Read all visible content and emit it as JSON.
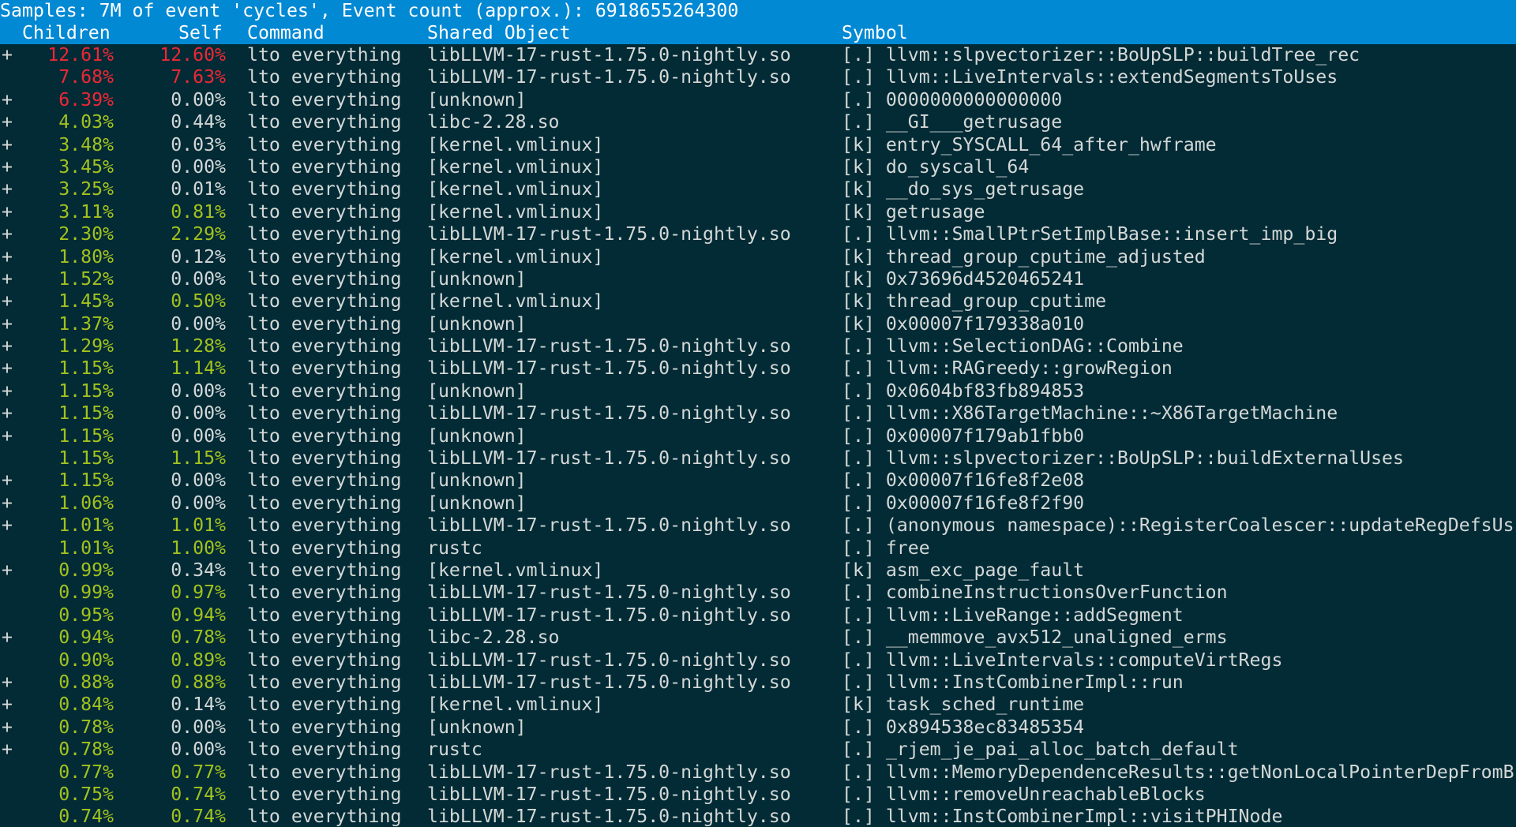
{
  "title": "Samples: 7M of event 'cycles', Event count (approx.): 6918655264300",
  "headers": {
    "children": "Children",
    "self": "Self",
    "command": "Command",
    "shared_object": "Shared Object",
    "symbol": "Symbol"
  },
  "colors": {
    "title_bar": "#0289d4",
    "background": "#022b36",
    "red": "#ee2834",
    "green": "#a3c21d",
    "default": "#d4d8d6"
  },
  "rows": [
    {
      "exp": "+",
      "children": "12.61%",
      "self": "12.60%",
      "cc": "red",
      "sc": "red",
      "cmd": "lto everything",
      "dso": "libLLVM-17-rust-1.75.0-nightly.so",
      "sym": "[.] llvm::slpvectorizer::BoUpSLP::buildTree_rec"
    },
    {
      "exp": "",
      "children": "7.68%",
      "self": "7.63%",
      "cc": "red",
      "sc": "red",
      "cmd": "lto everything",
      "dso": "libLLVM-17-rust-1.75.0-nightly.so",
      "sym": "[.] llvm::LiveIntervals::extendSegmentsToUses"
    },
    {
      "exp": "+",
      "children": "6.39%",
      "self": "0.00%",
      "cc": "red",
      "sc": "white",
      "cmd": "lto everything",
      "dso": "[unknown]",
      "sym": "[.] 0000000000000000"
    },
    {
      "exp": "+",
      "children": "4.03%",
      "self": "0.44%",
      "cc": "green",
      "sc": "white",
      "cmd": "lto everything",
      "dso": "libc-2.28.so",
      "sym": "[.] __GI___getrusage"
    },
    {
      "exp": "+",
      "children": "3.48%",
      "self": "0.03%",
      "cc": "green",
      "sc": "white",
      "cmd": "lto everything",
      "dso": "[kernel.vmlinux]",
      "sym": "[k] entry_SYSCALL_64_after_hwframe"
    },
    {
      "exp": "+",
      "children": "3.45%",
      "self": "0.00%",
      "cc": "green",
      "sc": "white",
      "cmd": "lto everything",
      "dso": "[kernel.vmlinux]",
      "sym": "[k] do_syscall_64"
    },
    {
      "exp": "+",
      "children": "3.25%",
      "self": "0.01%",
      "cc": "green",
      "sc": "white",
      "cmd": "lto everything",
      "dso": "[kernel.vmlinux]",
      "sym": "[k] __do_sys_getrusage"
    },
    {
      "exp": "+",
      "children": "3.11%",
      "self": "0.81%",
      "cc": "green",
      "sc": "green",
      "cmd": "lto everything",
      "dso": "[kernel.vmlinux]",
      "sym": "[k] getrusage"
    },
    {
      "exp": "+",
      "children": "2.30%",
      "self": "2.29%",
      "cc": "green",
      "sc": "green",
      "cmd": "lto everything",
      "dso": "libLLVM-17-rust-1.75.0-nightly.so",
      "sym": "[.] llvm::SmallPtrSetImplBase::insert_imp_big"
    },
    {
      "exp": "+",
      "children": "1.80%",
      "self": "0.12%",
      "cc": "green",
      "sc": "white",
      "cmd": "lto everything",
      "dso": "[kernel.vmlinux]",
      "sym": "[k] thread_group_cputime_adjusted"
    },
    {
      "exp": "+",
      "children": "1.52%",
      "self": "0.00%",
      "cc": "green",
      "sc": "white",
      "cmd": "lto everything",
      "dso": "[unknown]",
      "sym": "[k] 0x73696d4520465241"
    },
    {
      "exp": "+",
      "children": "1.45%",
      "self": "0.50%",
      "cc": "green",
      "sc": "green",
      "cmd": "lto everything",
      "dso": "[kernel.vmlinux]",
      "sym": "[k] thread_group_cputime"
    },
    {
      "exp": "+",
      "children": "1.37%",
      "self": "0.00%",
      "cc": "green",
      "sc": "white",
      "cmd": "lto everything",
      "dso": "[unknown]",
      "sym": "[k] 0x00007f179338a010"
    },
    {
      "exp": "+",
      "children": "1.29%",
      "self": "1.28%",
      "cc": "green",
      "sc": "green",
      "cmd": "lto everything",
      "dso": "libLLVM-17-rust-1.75.0-nightly.so",
      "sym": "[.] llvm::SelectionDAG::Combine"
    },
    {
      "exp": "+",
      "children": "1.15%",
      "self": "1.14%",
      "cc": "green",
      "sc": "green",
      "cmd": "lto everything",
      "dso": "libLLVM-17-rust-1.75.0-nightly.so",
      "sym": "[.] llvm::RAGreedy::growRegion"
    },
    {
      "exp": "+",
      "children": "1.15%",
      "self": "0.00%",
      "cc": "green",
      "sc": "white",
      "cmd": "lto everything",
      "dso": "[unknown]",
      "sym": "[.] 0x0604bf83fb894853"
    },
    {
      "exp": "+",
      "children": "1.15%",
      "self": "0.00%",
      "cc": "green",
      "sc": "white",
      "cmd": "lto everything",
      "dso": "libLLVM-17-rust-1.75.0-nightly.so",
      "sym": "[.] llvm::X86TargetMachine::~X86TargetMachine"
    },
    {
      "exp": "+",
      "children": "1.15%",
      "self": "0.00%",
      "cc": "green",
      "sc": "white",
      "cmd": "lto everything",
      "dso": "[unknown]",
      "sym": "[.] 0x00007f179ab1fbb0"
    },
    {
      "exp": "",
      "children": "1.15%",
      "self": "1.15%",
      "cc": "green",
      "sc": "green",
      "cmd": "lto everything",
      "dso": "libLLVM-17-rust-1.75.0-nightly.so",
      "sym": "[.] llvm::slpvectorizer::BoUpSLP::buildExternalUses"
    },
    {
      "exp": "+",
      "children": "1.15%",
      "self": "0.00%",
      "cc": "green",
      "sc": "white",
      "cmd": "lto everything",
      "dso": "[unknown]",
      "sym": "[.] 0x00007f16fe8f2e08"
    },
    {
      "exp": "+",
      "children": "1.06%",
      "self": "0.00%",
      "cc": "green",
      "sc": "white",
      "cmd": "lto everything",
      "dso": "[unknown]",
      "sym": "[.] 0x00007f16fe8f2f90"
    },
    {
      "exp": "+",
      "children": "1.01%",
      "self": "1.01%",
      "cc": "green",
      "sc": "green",
      "cmd": "lto everything",
      "dso": "libLLVM-17-rust-1.75.0-nightly.so",
      "sym": "[.] (anonymous namespace)::RegisterCoalescer::updateRegDefsUs"
    },
    {
      "exp": "",
      "children": "1.01%",
      "self": "1.00%",
      "cc": "green",
      "sc": "green",
      "cmd": "lto everything",
      "dso": "rustc",
      "sym": "[.] free"
    },
    {
      "exp": "+",
      "children": "0.99%",
      "self": "0.34%",
      "cc": "green",
      "sc": "white",
      "cmd": "lto everything",
      "dso": "[kernel.vmlinux]",
      "sym": "[k] asm_exc_page_fault"
    },
    {
      "exp": "",
      "children": "0.99%",
      "self": "0.97%",
      "cc": "green",
      "sc": "green",
      "cmd": "lto everything",
      "dso": "libLLVM-17-rust-1.75.0-nightly.so",
      "sym": "[.] combineInstructionsOverFunction"
    },
    {
      "exp": "",
      "children": "0.95%",
      "self": "0.94%",
      "cc": "green",
      "sc": "green",
      "cmd": "lto everything",
      "dso": "libLLVM-17-rust-1.75.0-nightly.so",
      "sym": "[.] llvm::LiveRange::addSegment"
    },
    {
      "exp": "+",
      "children": "0.94%",
      "self": "0.78%",
      "cc": "green",
      "sc": "green",
      "cmd": "lto everything",
      "dso": "libc-2.28.so",
      "sym": "[.] __memmove_avx512_unaligned_erms"
    },
    {
      "exp": "",
      "children": "0.90%",
      "self": "0.89%",
      "cc": "green",
      "sc": "green",
      "cmd": "lto everything",
      "dso": "libLLVM-17-rust-1.75.0-nightly.so",
      "sym": "[.] llvm::LiveIntervals::computeVirtRegs"
    },
    {
      "exp": "+",
      "children": "0.88%",
      "self": "0.88%",
      "cc": "green",
      "sc": "green",
      "cmd": "lto everything",
      "dso": "libLLVM-17-rust-1.75.0-nightly.so",
      "sym": "[.] llvm::InstCombinerImpl::run"
    },
    {
      "exp": "+",
      "children": "0.84%",
      "self": "0.14%",
      "cc": "green",
      "sc": "white",
      "cmd": "lto everything",
      "dso": "[kernel.vmlinux]",
      "sym": "[k] task_sched_runtime"
    },
    {
      "exp": "+",
      "children": "0.78%",
      "self": "0.00%",
      "cc": "green",
      "sc": "white",
      "cmd": "lto everything",
      "dso": "[unknown]",
      "sym": "[.] 0x894538ec83485354"
    },
    {
      "exp": "+",
      "children": "0.78%",
      "self": "0.00%",
      "cc": "green",
      "sc": "white",
      "cmd": "lto everything",
      "dso": "rustc",
      "sym": "[.] _rjem_je_pai_alloc_batch_default"
    },
    {
      "exp": "",
      "children": "0.77%",
      "self": "0.77%",
      "cc": "green",
      "sc": "green",
      "cmd": "lto everything",
      "dso": "libLLVM-17-rust-1.75.0-nightly.so",
      "sym": "[.] llvm::MemoryDependenceResults::getNonLocalPointerDepFromB"
    },
    {
      "exp": "",
      "children": "0.75%",
      "self": "0.74%",
      "cc": "green",
      "sc": "green",
      "cmd": "lto everything",
      "dso": "libLLVM-17-rust-1.75.0-nightly.so",
      "sym": "[.] llvm::removeUnreachableBlocks"
    },
    {
      "exp": "",
      "children": "0.74%",
      "self": "0.74%",
      "cc": "green",
      "sc": "green",
      "cmd": "lto everything",
      "dso": "libLLVM-17-rust-1.75.0-nightly.so",
      "sym": "[.] llvm::InstCombinerImpl::visitPHINode"
    }
  ]
}
